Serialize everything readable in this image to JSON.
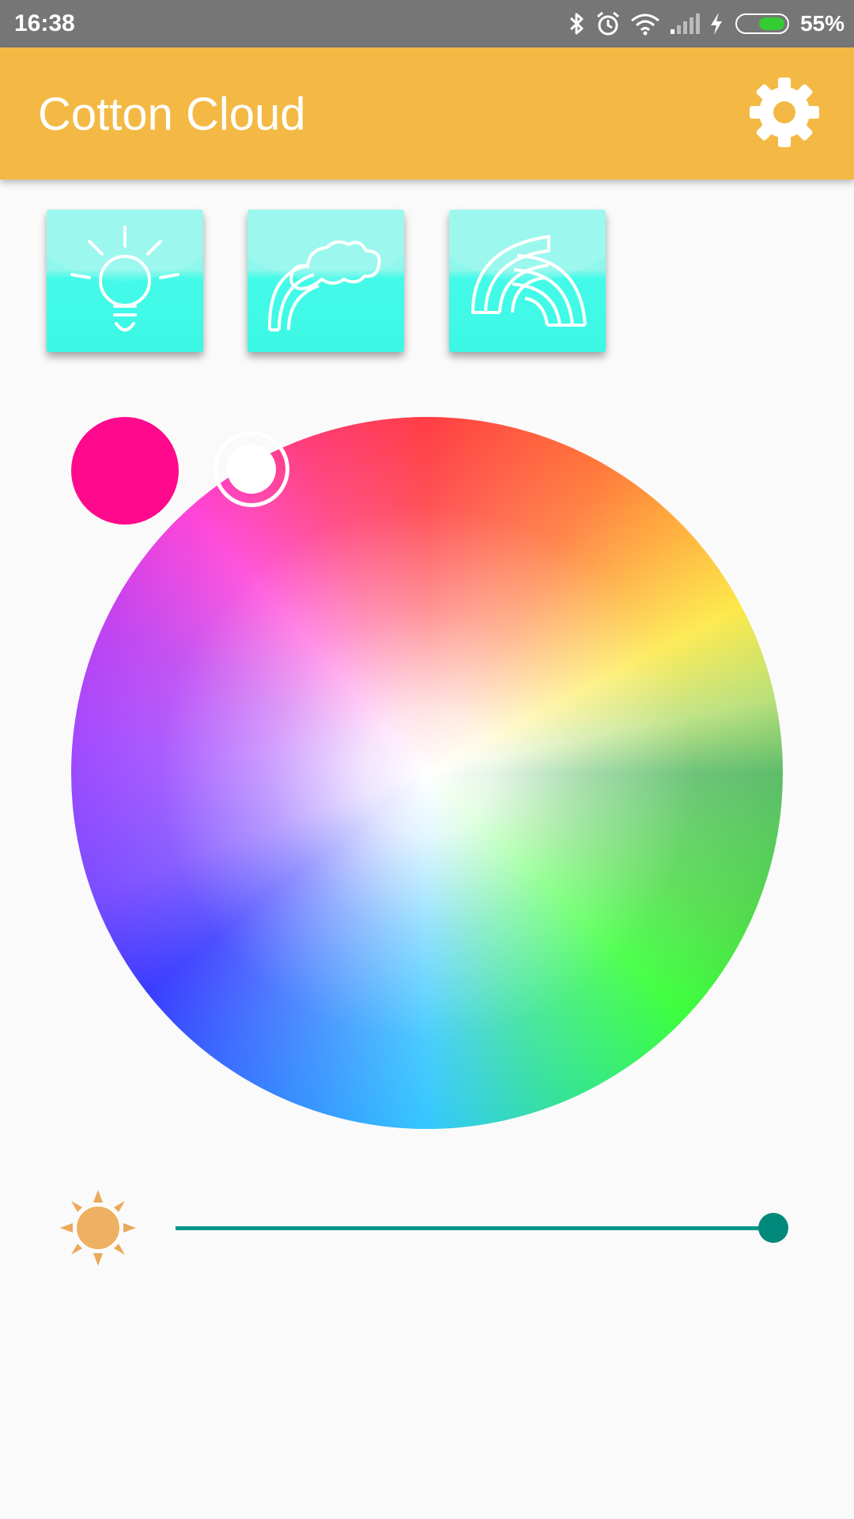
{
  "status_bar": {
    "time": "16:38",
    "battery_percent": "55%",
    "icons": [
      "bluetooth-icon",
      "alarm-icon",
      "wifi-icon",
      "signal-icon",
      "charging-icon",
      "battery-icon"
    ]
  },
  "app_bar": {
    "title": "Cotton Cloud",
    "settings_icon": "gear-icon",
    "background_color": "#f3b944"
  },
  "modes": [
    {
      "id": "bulb",
      "icon": "light-bulb-icon"
    },
    {
      "id": "cloud-rainbow",
      "icon": "cloud-rainbow-icon"
    },
    {
      "id": "rainbow",
      "icon": "rainbow-icon"
    }
  ],
  "color_picker": {
    "selected_color": "#ff0a8c",
    "thumb_color": "#ffffff"
  },
  "brightness": {
    "icon": "sun-icon",
    "value": 1.0,
    "track_color": "#009688"
  }
}
